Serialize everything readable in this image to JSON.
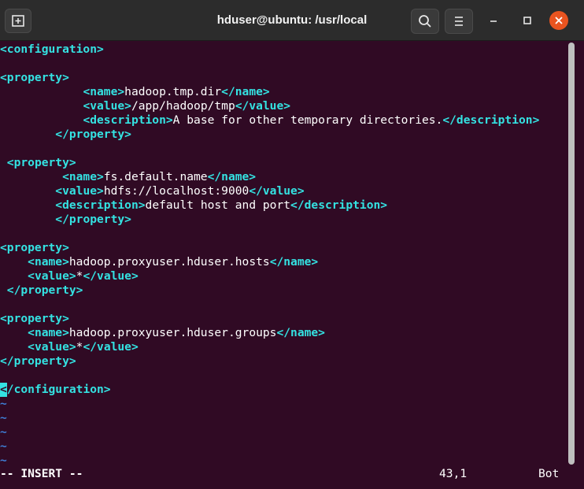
{
  "window": {
    "title": "hduser@ubuntu: /usr/local",
    "colors": {
      "background": "#300a24",
      "tag": "#34e2e2",
      "text": "#ffffff",
      "tilde": "#3f7fd7",
      "close": "#e95420"
    }
  },
  "editor": {
    "lines": [
      {
        "indent": "",
        "segments": [
          {
            "text": "<configuration>",
            "tag": true
          }
        ]
      },
      {
        "indent": "",
        "segments": []
      },
      {
        "indent": "",
        "segments": [
          {
            "text": "<property>",
            "tag": true
          }
        ]
      },
      {
        "indent": "            ",
        "segments": [
          {
            "text": "<name>",
            "tag": true
          },
          {
            "text": "hadoop.tmp.dir",
            "tag": false
          },
          {
            "text": "</name>",
            "tag": true
          }
        ]
      },
      {
        "indent": "            ",
        "segments": [
          {
            "text": "<value>",
            "tag": true
          },
          {
            "text": "/app/hadoop/tmp",
            "tag": false
          },
          {
            "text": "</value>",
            "tag": true
          }
        ]
      },
      {
        "indent": "            ",
        "segments": [
          {
            "text": "<description>",
            "tag": true
          },
          {
            "text": "A base for other temporary directories.",
            "tag": false
          },
          {
            "text": "</description>",
            "tag": true
          }
        ]
      },
      {
        "indent": "        ",
        "segments": [
          {
            "text": "</property>",
            "tag": true
          }
        ]
      },
      {
        "indent": "",
        "segments": []
      },
      {
        "indent": " ",
        "segments": [
          {
            "text": "<property>",
            "tag": true
          }
        ]
      },
      {
        "indent": "         ",
        "segments": [
          {
            "text": "<name>",
            "tag": true
          },
          {
            "text": "fs.default.name",
            "tag": false
          },
          {
            "text": "</name>",
            "tag": true
          }
        ]
      },
      {
        "indent": "        ",
        "segments": [
          {
            "text": "<value>",
            "tag": true
          },
          {
            "text": "hdfs://localhost:9000",
            "tag": false
          },
          {
            "text": "</value>",
            "tag": true
          }
        ]
      },
      {
        "indent": "        ",
        "segments": [
          {
            "text": "<description>",
            "tag": true
          },
          {
            "text": "default host and port",
            "tag": false
          },
          {
            "text": "</description>",
            "tag": true
          }
        ]
      },
      {
        "indent": "        ",
        "segments": [
          {
            "text": "</property>",
            "tag": true
          }
        ]
      },
      {
        "indent": "",
        "segments": []
      },
      {
        "indent": "",
        "segments": [
          {
            "text": "<property>",
            "tag": true
          }
        ]
      },
      {
        "indent": "    ",
        "segments": [
          {
            "text": "<name>",
            "tag": true
          },
          {
            "text": "hadoop.proxyuser.hduser.hosts",
            "tag": false
          },
          {
            "text": "</name>",
            "tag": true
          }
        ]
      },
      {
        "indent": "    ",
        "segments": [
          {
            "text": "<value>",
            "tag": true
          },
          {
            "text": "*",
            "tag": false
          },
          {
            "text": "</value>",
            "tag": true
          }
        ]
      },
      {
        "indent": " ",
        "segments": [
          {
            "text": "</property>",
            "tag": true
          }
        ]
      },
      {
        "indent": "",
        "segments": []
      },
      {
        "indent": "",
        "segments": [
          {
            "text": "<property>",
            "tag": true
          }
        ]
      },
      {
        "indent": "    ",
        "segments": [
          {
            "text": "<name>",
            "tag": true
          },
          {
            "text": "hadoop.proxyuser.hduser.groups",
            "tag": false
          },
          {
            "text": "</name>",
            "tag": true
          }
        ]
      },
      {
        "indent": "    ",
        "segments": [
          {
            "text": "<value>",
            "tag": true
          },
          {
            "text": "*",
            "tag": false
          },
          {
            "text": "</value>",
            "tag": true
          }
        ]
      },
      {
        "indent": "",
        "segments": [
          {
            "text": "</property>",
            "tag": true
          }
        ]
      },
      {
        "indent": "",
        "segments": []
      },
      {
        "indent": "",
        "cursor": true,
        "segments": [
          {
            "text": "/configuration>",
            "tag": true
          }
        ],
        "cursor_char": "<"
      },
      {
        "indent": "",
        "segments": [
          {
            "text": "~",
            "tilde": true
          }
        ]
      },
      {
        "indent": "",
        "segments": [
          {
            "text": "~",
            "tilde": true
          }
        ]
      },
      {
        "indent": "",
        "segments": [
          {
            "text": "~",
            "tilde": true
          }
        ]
      },
      {
        "indent": "",
        "segments": [
          {
            "text": "~",
            "tilde": true
          }
        ]
      },
      {
        "indent": "",
        "segments": [
          {
            "text": "~",
            "tilde": true
          }
        ]
      }
    ]
  },
  "status": {
    "mode": "-- INSERT --",
    "position": "43,1",
    "scroll": "Bot"
  },
  "icons": {
    "new_tab": "new-tab-icon",
    "search": "search-icon",
    "menu": "hamburger-menu-icon",
    "minimize": "minimize-icon",
    "maximize": "maximize-icon",
    "close": "close-icon"
  }
}
